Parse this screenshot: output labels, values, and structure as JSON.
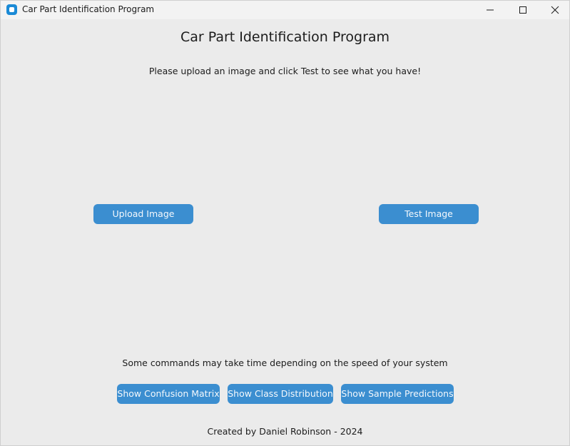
{
  "window": {
    "title": "Car Part Identification Program"
  },
  "header": {
    "title": "Car Part Identification Program",
    "instruction": "Please upload an image and click Test to see what you have!"
  },
  "main": {
    "upload_label": "Upload Image",
    "test_label": "Test Image"
  },
  "commands": {
    "note": "Some commands may take time depending on the speed of your system",
    "confusion_label": "Show Confusion Matrix",
    "distribution_label": "Show Class Distribution",
    "predictions_label": "Show Sample Predictions"
  },
  "footer": {
    "credit": "Created by Daniel Robinson - 2024"
  },
  "colors": {
    "background": "#ebebeb",
    "titlebar": "#f3f3f3",
    "button": "#3b8ed0",
    "button_text": "#f4f8fc",
    "app_icon": "#1a8ad6"
  },
  "icons": {
    "app": "app-icon",
    "minimize": "minimize-icon",
    "maximize": "maximize-icon",
    "close": "close-icon"
  }
}
